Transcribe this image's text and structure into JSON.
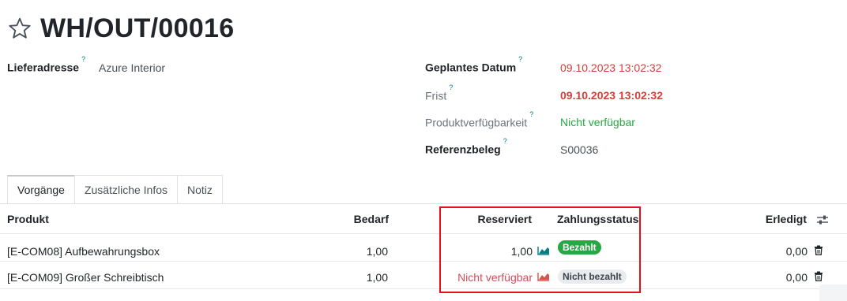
{
  "record": {
    "title": "WH/OUT/00016"
  },
  "fields": {
    "delivery_address": {
      "label": "Lieferadresse",
      "tooltip": "?",
      "value": "Azure Interior"
    },
    "scheduled_date": {
      "label": "Geplantes Datum",
      "tooltip": "?",
      "value": "09.10.2023 13:02:32"
    },
    "deadline": {
      "label": "Frist",
      "tooltip": "?",
      "value": "09.10.2023 13:02:32"
    },
    "availability": {
      "label": "Produktverfügbarkeit",
      "tooltip": "?",
      "value": "Nicht verfügbar"
    },
    "source_document": {
      "label": "Referenzbeleg",
      "tooltip": "?",
      "value": "S00036"
    }
  },
  "tabs": [
    {
      "label": "Vorgänge",
      "active": true
    },
    {
      "label": "Zusätzliche Infos",
      "active": false
    },
    {
      "label": "Notiz",
      "active": false
    }
  ],
  "table": {
    "headers": {
      "product": "Produkt",
      "demand": "Bedarf",
      "reserved": "Reserviert",
      "payment_status": "Zahlungsstatus",
      "done": "Erledigt"
    },
    "rows": [
      {
        "product": "[E-COM08] Aufbewahrungsbox",
        "demand": "1,00",
        "reserved": "1,00",
        "payment_status": "Bezahlt",
        "done": "0,00"
      },
      {
        "product": "[E-COM09] Großer Schreibtisch",
        "demand": "1,00",
        "reserved": "Nicht verfügbar",
        "payment_status": "Nicht bezahlt",
        "done": "0,00"
      }
    ]
  },
  "icons": {
    "favorite": "star-outline-icon",
    "forecast": "area-chart-icon",
    "delete": "trash-icon",
    "optional_columns": "sliders-icon"
  },
  "colors": {
    "danger": "#d44c59",
    "date_red": "#d23f3a",
    "success": "#28a745",
    "forecast_ok": "#017e84",
    "forecast_bad": "#d9534f",
    "badge_paid_bg": "#28a745",
    "badge_unpaid_bg": "#e9ecef",
    "highlight_border": "#e5101a"
  }
}
